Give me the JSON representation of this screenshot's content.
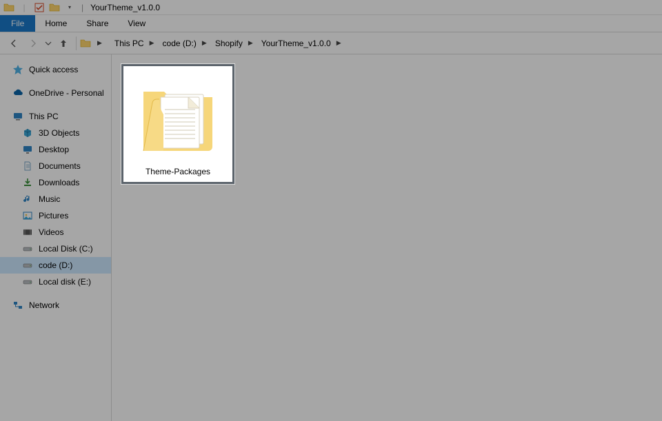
{
  "window": {
    "title": "YourTheme_v1.0.0"
  },
  "ribbon": {
    "file": "File",
    "tabs": [
      "Home",
      "Share",
      "View"
    ]
  },
  "breadcrumbs": [
    "This PC",
    "code (D:)",
    "Shopify",
    "YourTheme_v1.0.0"
  ],
  "sidebar": {
    "quick_access": "Quick access",
    "onedrive": "OneDrive - Personal",
    "this_pc": "This PC",
    "children": [
      {
        "label": "3D Objects"
      },
      {
        "label": "Desktop"
      },
      {
        "label": "Documents"
      },
      {
        "label": "Downloads"
      },
      {
        "label": "Music"
      },
      {
        "label": "Pictures"
      },
      {
        "label": "Videos"
      },
      {
        "label": "Local Disk (C:)"
      },
      {
        "label": "code (D:)"
      },
      {
        "label": "Local disk (E:)"
      }
    ],
    "network": "Network"
  },
  "content": {
    "items": [
      {
        "label": "Theme-Packages"
      }
    ]
  }
}
